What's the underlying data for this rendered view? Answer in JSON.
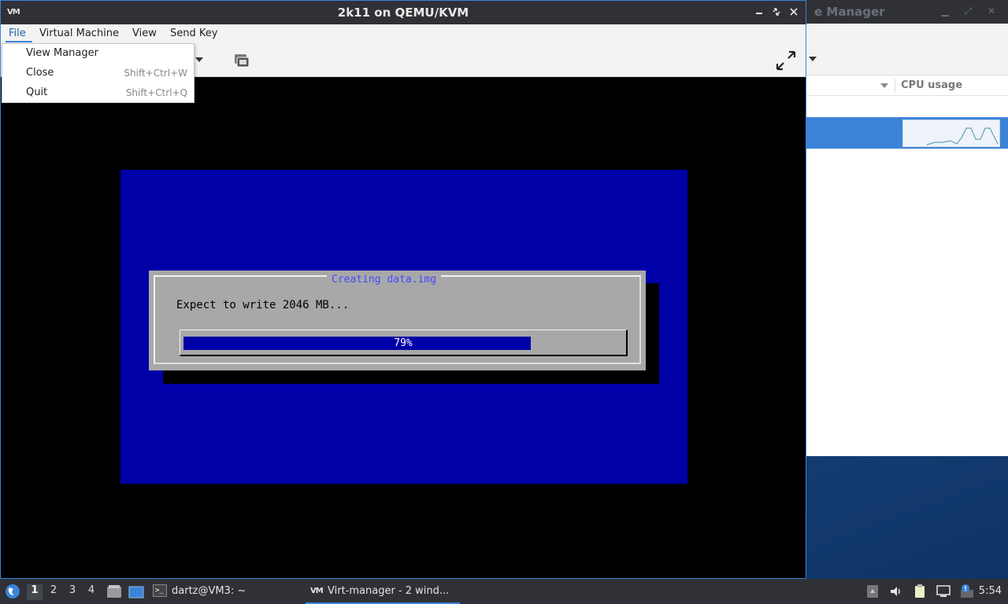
{
  "background_window": {
    "title_fragment": "e Manager",
    "column_header": "CPU usage"
  },
  "vm_window": {
    "title": "2k11 on QEMU/KVM",
    "app_icon_text": "VM",
    "menubar": {
      "file": "File",
      "virtual_machine": "Virtual Machine",
      "view": "View",
      "send_key": "Send Key"
    },
    "file_menu": [
      {
        "label": "View Manager",
        "accel": ""
      },
      {
        "label": "Close",
        "accel": "Shift+Ctrl+W"
      },
      {
        "label": "Quit",
        "accel": "Shift+Ctrl+Q"
      }
    ]
  },
  "guest_console": {
    "dialog_title": "Creating data.img",
    "message": "Expect to write 2046 MB...",
    "progress_percent": 79,
    "progress_text": "79%"
  },
  "taskbar": {
    "workspaces": [
      "1",
      "2",
      "3",
      "4"
    ],
    "active_workspace": "1",
    "terminal_task": "dartz@VM3: ~",
    "virt_task": "Virt-manager - 2 wind...",
    "virt_icon_text": "VM",
    "clock": "5:54"
  },
  "colors": {
    "titlebar": "#2f3136",
    "accent": "#3b83d9",
    "dos_blue": "#0000a8",
    "dialog_gray": "#a8a8a8",
    "dialog_title": "#4646ff"
  },
  "icons": {
    "start": "start-menu-icon",
    "files": "file-manager-icon",
    "desktop": "show-desktop-icon",
    "terminal": "terminal-icon",
    "tray": [
      "network-icon",
      "volume-icon",
      "clipboard-icon",
      "monitor-icon",
      "notification-icon"
    ]
  }
}
